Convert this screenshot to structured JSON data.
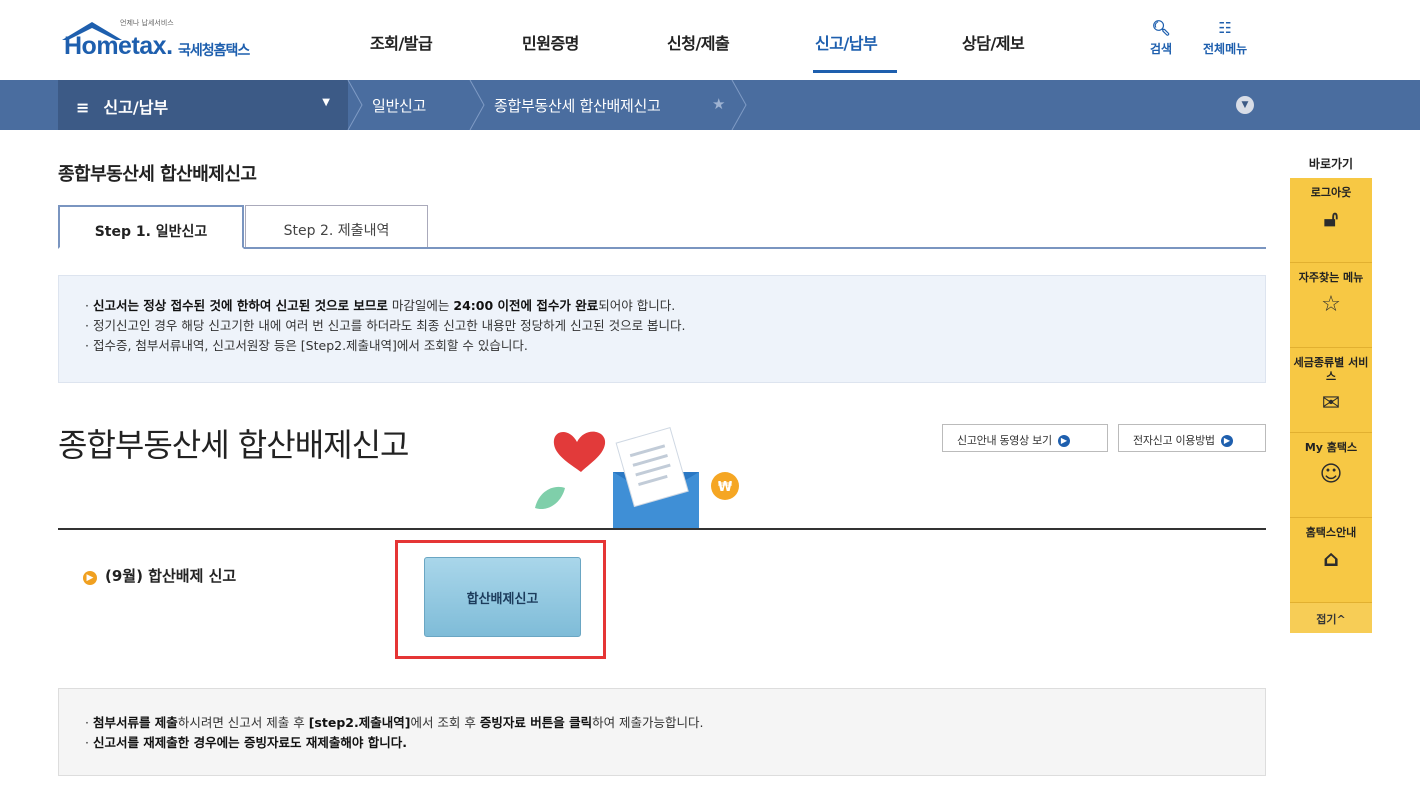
{
  "logo": {
    "brand": "Hometax.",
    "brand_kr": "국세청홈택스",
    "tag": "언제나 납세서비스"
  },
  "gnb": [
    "조회/발급",
    "민원증명",
    "신청/제출",
    "신고/납부",
    "상담/제보"
  ],
  "util": {
    "search_label": "검색",
    "menu_label": "전체메뉴"
  },
  "breadcrumb": {
    "menu": "신고/납부",
    "level1": "일반신고",
    "level2": "종합부동산세 합산배제신고"
  },
  "page": {
    "title": "종합부동산세 합산배제신고"
  },
  "tabs": [
    "Step 1. 일반신고",
    "Step 2. 제출내역"
  ],
  "notice1": {
    "l1_b1": "신고서는 정상 접수된 것에 한하여 신고된 것으로 보므로",
    "l1_t1": " 마감일에는 ",
    "l1_b2": "24:00 이전에 접수가 완료",
    "l1_t2": "되어야 합니다.",
    "l2": "정기신고인 경우 해당 신고기한 내에 여러 번 신고를 하더라도 최종 신고한 내용만 정당하게 신고된 것으로 봅니다.",
    "l3": "접수증, 첨부서류내역, 신고서원장 등은 [Step2.제출내역]에서 조회할 수 있습니다."
  },
  "main_title": "종합부동산세 합산배제신고",
  "buttons": {
    "video": "신고안내 동영상 보기",
    "guide": "전자신고 이용방법"
  },
  "section": {
    "label": "(9월) 합산배제 신고",
    "submit": "합산배제신고"
  },
  "notice2": {
    "l1_b1": "첨부서류를 제출",
    "l1_t1": "하시려면 신고서 제출 후 ",
    "l1_b2": "[step2.제출내역]",
    "l1_t2": "에서 조회 후 ",
    "l1_b3": "증빙자료 버튼을 클릭",
    "l1_t3": "하여 제출가능합니다.",
    "l2": "신고서를 재제출한 경우에는 증빙자료도 재제출해야 합니다."
  },
  "quick": {
    "title": "바로가기",
    "items": [
      "로그아웃",
      "자주찾는 메뉴",
      "세금종류별 서비스",
      "My 홈택스",
      "홈택스안내"
    ],
    "fold": "접기^"
  },
  "colors": {
    "brand": "#1e5fae",
    "bar": "#4a6d9f",
    "quick": "#f7c844",
    "highlight": "#e53535"
  }
}
